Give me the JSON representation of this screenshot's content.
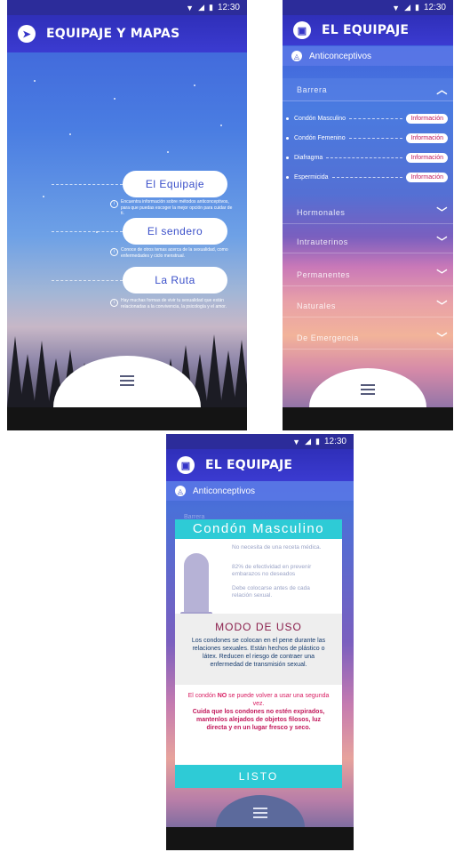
{
  "status": {
    "time": "12:30"
  },
  "screen1": {
    "title": "EQUIPAJE Y MAPAS",
    "cards": [
      {
        "label": "El Equipaje",
        "desc": "Encuentra información sobre métodos anticonceptivos, para que puedas escoger la mejor opción para cuidar de ti."
      },
      {
        "label": "El sendero",
        "desc": "Conoce de otros temas acerca de la sexualidad, como enfermedades y ciclo menstrual."
      },
      {
        "label": "La Ruta",
        "desc": "Hay muchas formas de vivir tu sexualidad que están relacionadas a la convivencia, la psicología y el amor."
      }
    ]
  },
  "screen2": {
    "title": "EL EQUIPAJE",
    "subtitle": "Anticonceptivos",
    "expanded": "Barrera",
    "items": [
      {
        "label": "Condón Masculino",
        "button": "Información"
      },
      {
        "label": "Condón Femenino",
        "button": "Información"
      },
      {
        "label": "Diafragma",
        "button": "Información"
      },
      {
        "label": "Espermicida",
        "button": "Información"
      }
    ],
    "categories": [
      "Hormonales",
      "Intrauterinos",
      "Permanentes",
      "Naturales",
      "De Emergencia"
    ]
  },
  "screen3": {
    "title": "EL EQUIPAJE",
    "subtitle": "Anticonceptivos",
    "behind": "Barrera",
    "modal": {
      "title": "Condón Masculino",
      "features": [
        "No necesita de una receta médica.",
        "82% de efectividad en prevenir embarazos no deseados",
        "Debe colocarse antes de cada relación sexual."
      ],
      "usage_title": "MODO DE USO",
      "usage_text": "Los condones se colocan en el pene durante las relaciones sexuales. Están hechos de plástico o látex. Reducen el riesgo de contraer una enfermedad de transmisión sexual.",
      "warn_pre": "El condón ",
      "warn_bold": "NO",
      "warn_post": " se puede volver a usar una segunda vez.",
      "warn_strong": "Cuida que los condones no estén expirados, mantenlos alejados de objetos filosos, luz directa y en un lugar fresco y seco.",
      "button": "LISTO"
    }
  }
}
